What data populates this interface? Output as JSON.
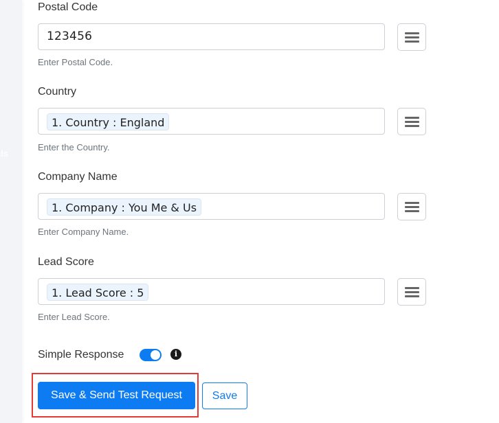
{
  "sidebar": {
    "partial_label": "als"
  },
  "fields": [
    {
      "label": "Postal Code",
      "value": "123456",
      "chip": null,
      "help": "Enter Postal Code."
    },
    {
      "label": "Country",
      "value": null,
      "chip": "1. Country : England",
      "help": "Enter the Country."
    },
    {
      "label": "Company Name",
      "value": null,
      "chip": "1. Company : You Me & Us",
      "help": "Enter Company Name."
    },
    {
      "label": "Lead Score",
      "value": null,
      "chip": "1. Lead Score : 5",
      "help": "Enter Lead Score."
    }
  ],
  "simple_response": {
    "label": "Simple Response",
    "enabled": true,
    "info_glyph": "i"
  },
  "actions": {
    "save_send_label": "Save & Send Test Request",
    "save_label": "Save"
  },
  "colors": {
    "primary": "#0d7bf2",
    "highlight": "#e53935"
  }
}
